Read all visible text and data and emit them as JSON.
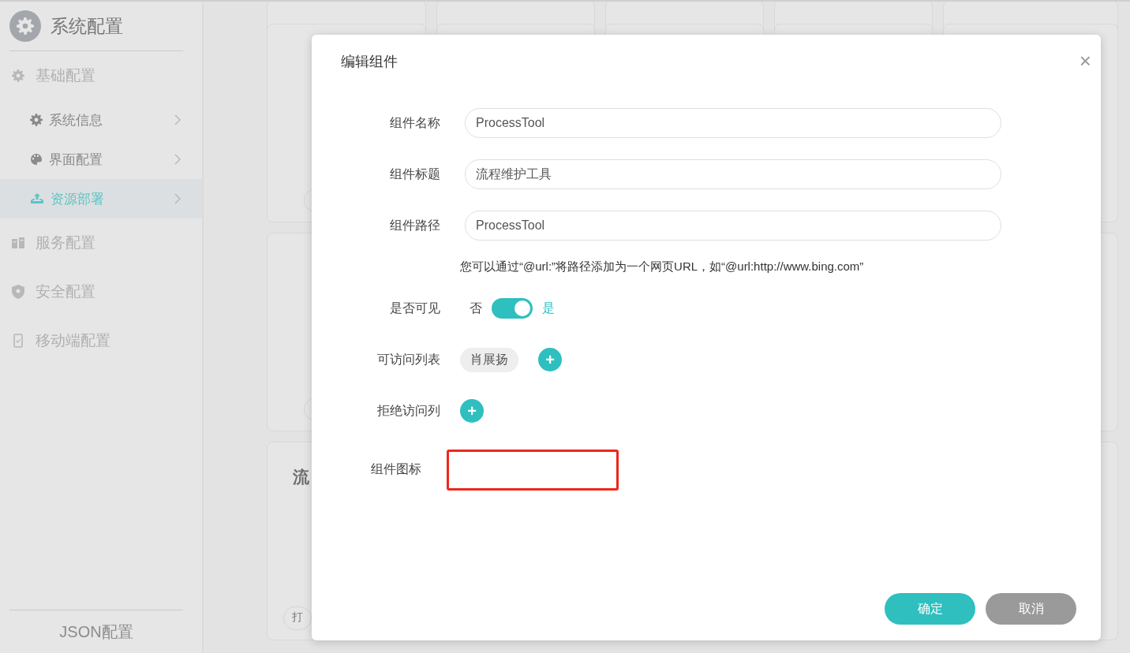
{
  "sidebar": {
    "title": "系统配置",
    "items": [
      {
        "label": "基础配置",
        "children": [
          {
            "label": "系统信息",
            "selected": false
          },
          {
            "label": "界面配置",
            "selected": false
          },
          {
            "label": "资源部署",
            "selected": true
          }
        ]
      },
      {
        "label": "服务配置"
      },
      {
        "label": "安全配置"
      },
      {
        "label": "移动端配置"
      }
    ],
    "footer": "JSON配置"
  },
  "cards": [
    {
      "kind": "title",
      "text": "流"
    },
    {
      "kind": "pill",
      "text": "打"
    }
  ],
  "dialog": {
    "title": "编辑组件",
    "close": "×",
    "fields": [
      {
        "label": "组件名称",
        "value": "ProcessTool"
      },
      {
        "label": "组件标题",
        "value": "流程维护工具"
      },
      {
        "label": "组件路径",
        "value": "ProcessTool"
      }
    ],
    "hint": "您可以通过“@url:”将路径添加为一个网页URL，如“@url:http://www.bing.com”",
    "visible": {
      "label": "是否可见",
      "off_label": "否",
      "on_label": "是",
      "on": true
    },
    "allow_list": {
      "label": "可访问列表",
      "tags": [
        "肖展扬"
      ],
      "add": "+"
    },
    "deny_list": {
      "label": "拒绝访问列",
      "add": "+"
    },
    "icon_field": {
      "label": "组件图标",
      "highlighted": true
    },
    "buttons": [
      {
        "label": "确定",
        "kind": "primary"
      },
      {
        "label": "取消",
        "kind": "secondary"
      }
    ]
  }
}
